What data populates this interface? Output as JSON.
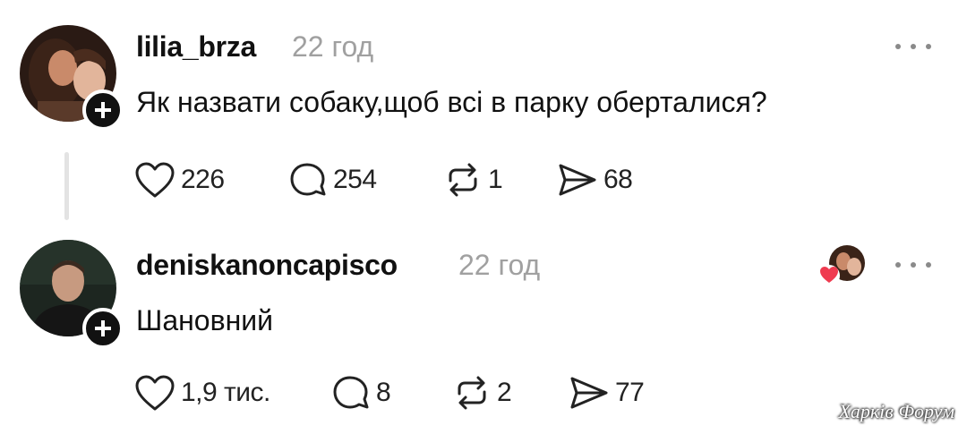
{
  "posts": [
    {
      "username": "lilia_brza",
      "time": "22 год",
      "text": "Як назвати собаку,щоб всі в парку оберталися?",
      "likes": "226",
      "replies": "254",
      "reposts": "1",
      "shares": "68"
    },
    {
      "username": "deniskanoncapisco",
      "time": "22 год",
      "text": "Шановний",
      "likes": "1,9 тис.",
      "replies": "8",
      "reposts": "2",
      "shares": "77"
    }
  ],
  "watermark": "Харків Форум",
  "colors": {
    "text": "#111111",
    "muted": "#a0a0a0",
    "thread_line": "#e3e3e3",
    "heart_red": "#ef3b50"
  },
  "icons": [
    "heart-icon",
    "comment-icon",
    "repost-icon",
    "share-icon",
    "plus-icon",
    "more-icon"
  ]
}
